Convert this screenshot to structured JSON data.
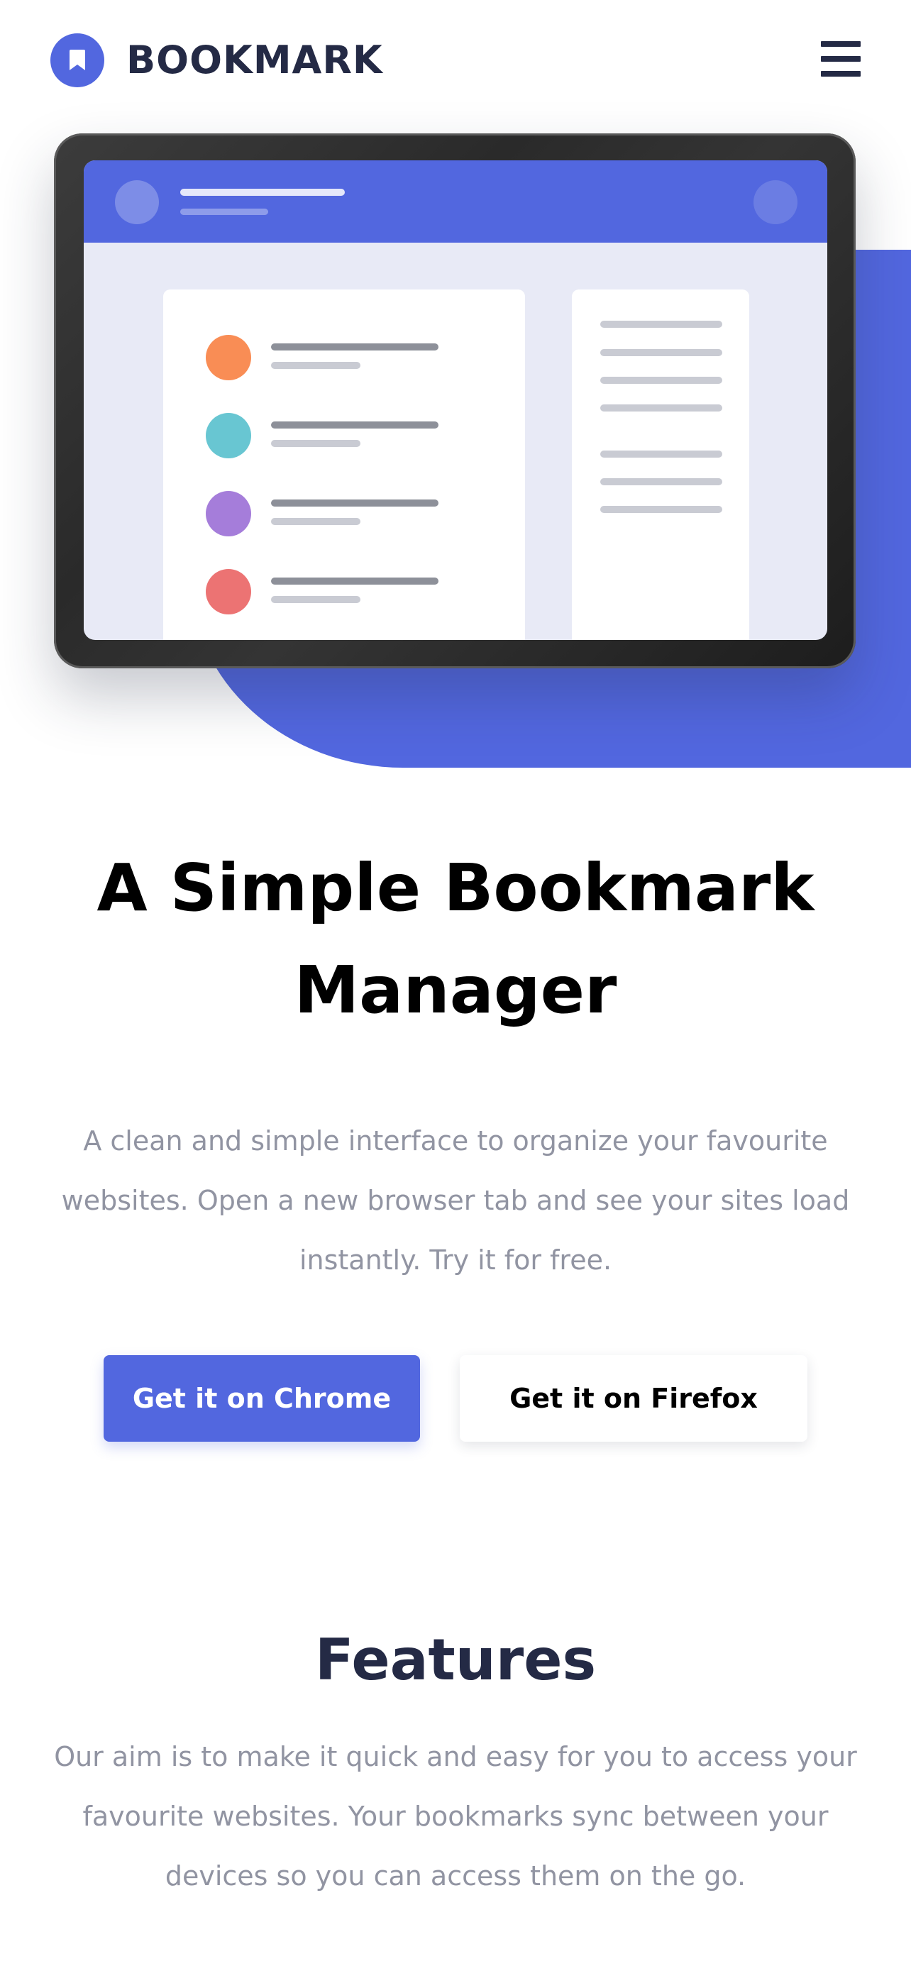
{
  "brand": {
    "name": "BOOKMARK",
    "accent_color": "#5267DF",
    "dark_color": "#242A45"
  },
  "header": {
    "menu_icon": "hamburger-menu-icon"
  },
  "illustration": {
    "bookmark_dot_colors": [
      "#F98D55",
      "#68C6D2",
      "#A57DDA",
      "#EC7373"
    ]
  },
  "hero": {
    "title": "A Simple Bookmark Manager",
    "description": "A clean and simple interface to organize your favourite websites. Open a new browser tab and see your sites load instantly. Try it for free.",
    "chrome_button": "Get it on Chrome",
    "firefox_button": "Get it on Firefox"
  },
  "features": {
    "title": "Features",
    "description": "Our aim is to make it quick and easy for you to access your favourite websites. Your bookmarks sync between your devices so you can access them on the go."
  }
}
